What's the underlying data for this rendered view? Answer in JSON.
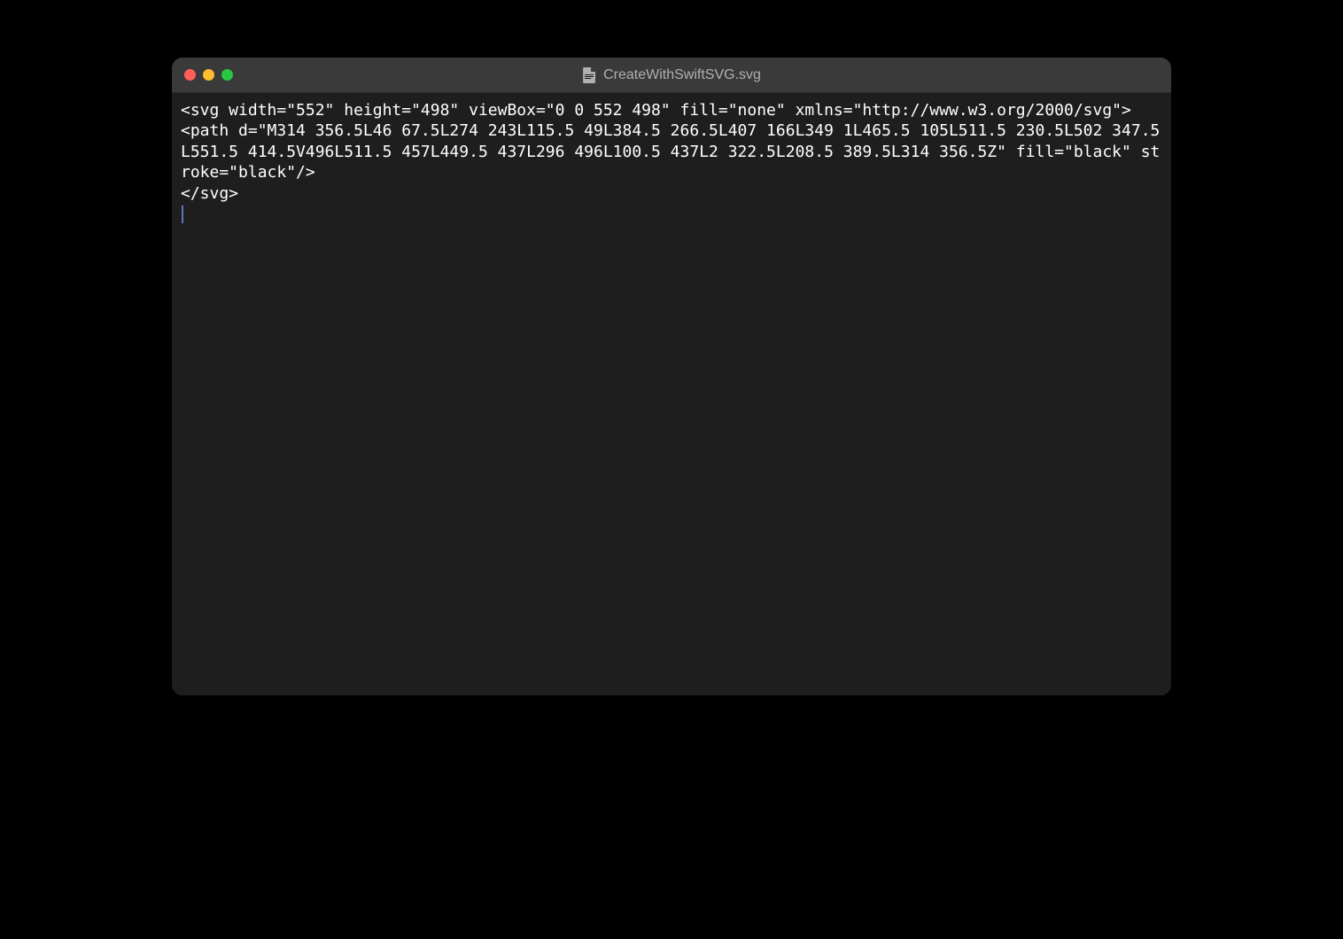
{
  "window": {
    "title": "CreateWithSwiftSVG.svg"
  },
  "content": {
    "lines": [
      "<svg width=\"552\" height=\"498\" viewBox=\"0 0 552 498\" fill=\"none\" xmlns=\"http://www.w3.org/2000/svg\">",
      "<path d=\"M314 356.5L46 67.5L274 243L115.5 49L384.5 266.5L407 166L349 1L465.5 105L511.5 230.5L502 347.5L551.5 414.5V496L511.5 457L449.5 437L296 496L100.5 437L2 322.5L208.5 389.5L314 356.5Z\" fill=\"black\" stroke=\"black\"/>",
      "</svg>"
    ]
  }
}
